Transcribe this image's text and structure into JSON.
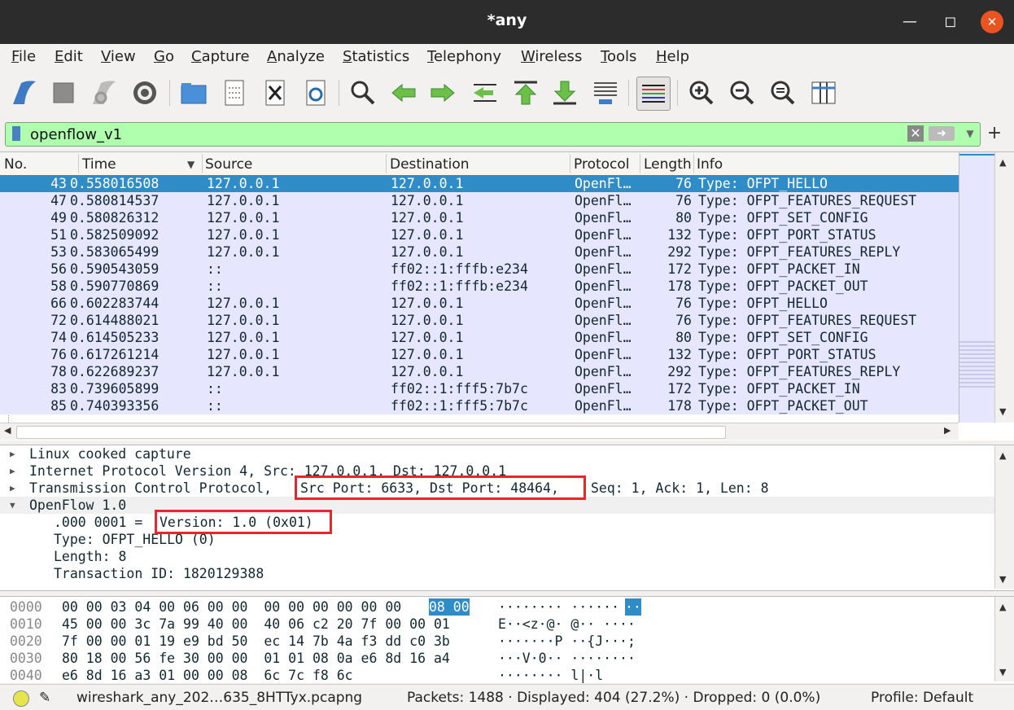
{
  "window": {
    "title": "*any"
  },
  "menu": [
    "File",
    "Edit",
    "View",
    "Go",
    "Capture",
    "Analyze",
    "Statistics",
    "Telephony",
    "Wireless",
    "Tools",
    "Help"
  ],
  "filter": {
    "value": "openflow_v1"
  },
  "columns": {
    "no": "No.",
    "time": "Time",
    "source": "Source",
    "destination": "Destination",
    "protocol": "Protocol",
    "length": "Length",
    "info": "Info"
  },
  "packets": [
    {
      "no": "43",
      "time": "0.558016508",
      "src": "127.0.0.1",
      "dst": "127.0.0.1",
      "proto": "OpenFl…",
      "len": "76",
      "info": "Type: OFPT_HELLO"
    },
    {
      "no": "47",
      "time": "0.580814537",
      "src": "127.0.0.1",
      "dst": "127.0.0.1",
      "proto": "OpenFl…",
      "len": "76",
      "info": "Type: OFPT_FEATURES_REQUEST"
    },
    {
      "no": "49",
      "time": "0.580826312",
      "src": "127.0.0.1",
      "dst": "127.0.0.1",
      "proto": "OpenFl…",
      "len": "80",
      "info": "Type: OFPT_SET_CONFIG"
    },
    {
      "no": "51",
      "time": "0.582509092",
      "src": "127.0.0.1",
      "dst": "127.0.0.1",
      "proto": "OpenFl…",
      "len": "132",
      "info": "Type: OFPT_PORT_STATUS"
    },
    {
      "no": "53",
      "time": "0.583065499",
      "src": "127.0.0.1",
      "dst": "127.0.0.1",
      "proto": "OpenFl…",
      "len": "292",
      "info": "Type: OFPT_FEATURES_REPLY"
    },
    {
      "no": "56",
      "time": "0.590543059",
      "src": "::",
      "dst": "ff02::1:fffb:e234",
      "proto": "OpenFl…",
      "len": "172",
      "info": "Type: OFPT_PACKET_IN"
    },
    {
      "no": "58",
      "time": "0.590770869",
      "src": "::",
      "dst": "ff02::1:fffb:e234",
      "proto": "OpenFl…",
      "len": "178",
      "info": "Type: OFPT_PACKET_OUT"
    },
    {
      "no": "66",
      "time": "0.602283744",
      "src": "127.0.0.1",
      "dst": "127.0.0.1",
      "proto": "OpenFl…",
      "len": "76",
      "info": "Type: OFPT_HELLO"
    },
    {
      "no": "72",
      "time": "0.614488021",
      "src": "127.0.0.1",
      "dst": "127.0.0.1",
      "proto": "OpenFl…",
      "len": "76",
      "info": "Type: OFPT_FEATURES_REQUEST"
    },
    {
      "no": "74",
      "time": "0.614505233",
      "src": "127.0.0.1",
      "dst": "127.0.0.1",
      "proto": "OpenFl…",
      "len": "80",
      "info": "Type: OFPT_SET_CONFIG"
    },
    {
      "no": "76",
      "time": "0.617261214",
      "src": "127.0.0.1",
      "dst": "127.0.0.1",
      "proto": "OpenFl…",
      "len": "132",
      "info": "Type: OFPT_PORT_STATUS"
    },
    {
      "no": "78",
      "time": "0.622689237",
      "src": "127.0.0.1",
      "dst": "127.0.0.1",
      "proto": "OpenFl…",
      "len": "292",
      "info": "Type: OFPT_FEATURES_REPLY"
    },
    {
      "no": "83",
      "time": "0.739605899",
      "src": "::",
      "dst": "ff02::1:fff5:7b7c",
      "proto": "OpenFl…",
      "len": "172",
      "info": "Type: OFPT_PACKET_IN"
    },
    {
      "no": "85",
      "time": "0.740393356",
      "src": "::",
      "dst": "ff02::1:fff5:7b7c",
      "proto": "OpenFl…",
      "len": "178",
      "info": "Type: OFPT_PACKET_OUT"
    }
  ],
  "details": {
    "linux": "Linux cooked capture",
    "ip": "Internet Protocol Version 4, Src: 127.0.0.1, Dst: 127.0.0.1",
    "tcp_prefix": "Transmission Control Protocol,",
    "tcp_ports": "Src Port: 6633, Dst Port: 48464,",
    "tcp_suffix": "Seq: 1, Ack: 1, Len: 8",
    "openflow": "OpenFlow 1.0",
    "version_prefix": ".000 0001 =",
    "version_value": "Version: 1.0 (0x01)",
    "type": "Type: OFPT_HELLO (0)",
    "length": "Length: 8",
    "xid": "Transaction ID: 1820129388"
  },
  "hex": [
    {
      "off": "0000",
      "bytes": "00 00 03 04 00 06 00 00  00 00 00 00 00 00",
      "sel": "08 00",
      "ascii": "········ ······",
      "ascii_sel": "··"
    },
    {
      "off": "0010",
      "bytes": "45 00 00 3c 7a 99 40 00  40 06 c2 20 7f 00 00 01",
      "sel": "",
      "ascii": "E··<z·@· @·· ····",
      "ascii_sel": ""
    },
    {
      "off": "0020",
      "bytes": "7f 00 00 01 19 e9 bd 50  ec 14 7b 4a f3 dd c0 3b",
      "sel": "",
      "ascii": "·······P ··{J···;",
      "ascii_sel": ""
    },
    {
      "off": "0030",
      "bytes": "80 18 00 56 fe 30 00 00  01 01 08 0a e6 8d 16 a4",
      "sel": "",
      "ascii": "···V·0·· ········",
      "ascii_sel": ""
    },
    {
      "off": "0040",
      "bytes": "e6 8d 16 a3 01 00 00 08  6c 7c f8 6c",
      "sel": "",
      "ascii": "········ l|·l",
      "ascii_sel": ""
    }
  ],
  "status": {
    "file": "wireshark_any_202…635_8HTTyx.pcapng",
    "stats": "Packets: 1488 · Displayed: 404 (27.2%) · Dropped: 0 (0.0%)",
    "profile": "Profile: Default"
  }
}
